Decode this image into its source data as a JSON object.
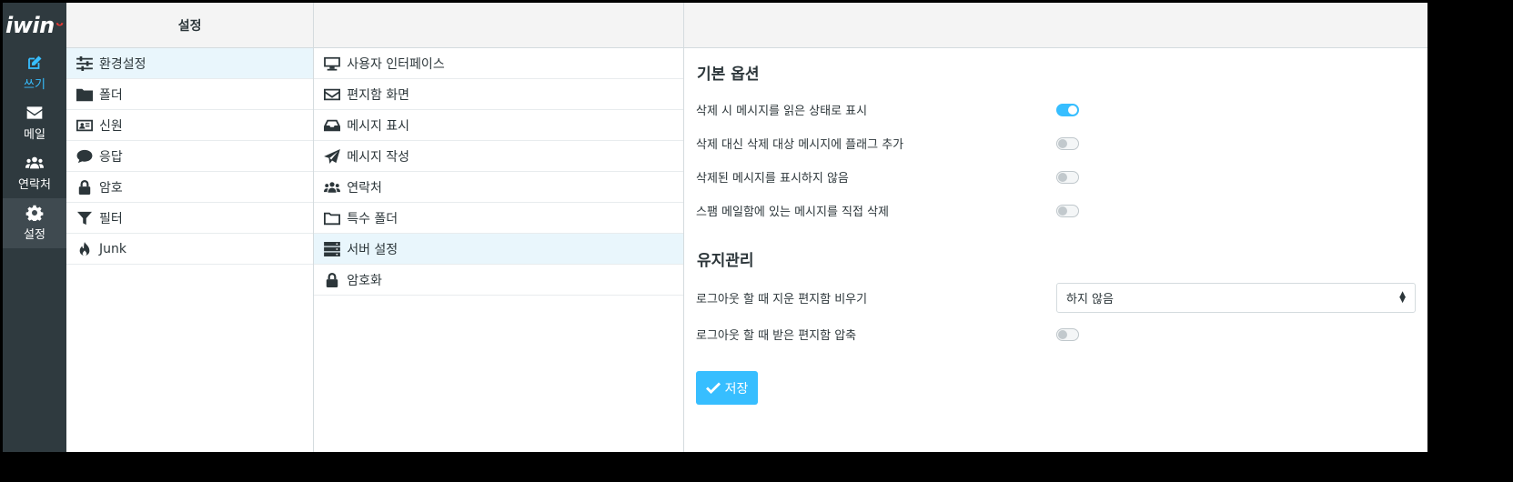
{
  "logo": {
    "text": "iwin",
    "mark": "ᵕ"
  },
  "nav": [
    {
      "label": "쓰기",
      "icon": "compose-icon"
    },
    {
      "label": "메일",
      "icon": "envelope-icon"
    },
    {
      "label": "연락처",
      "icon": "contacts-icon"
    },
    {
      "label": "설정",
      "icon": "gear-icon"
    }
  ],
  "col1": {
    "header": "설정",
    "items": [
      {
        "label": "환경설정",
        "icon": "sliders-icon"
      },
      {
        "label": "폴더",
        "icon": "folder-icon"
      },
      {
        "label": "신원",
        "icon": "id-card-icon"
      },
      {
        "label": "응답",
        "icon": "comment-icon"
      },
      {
        "label": "암호",
        "icon": "lock-icon"
      },
      {
        "label": "필터",
        "icon": "filter-icon"
      },
      {
        "label": "Junk",
        "icon": "fire-icon"
      }
    ]
  },
  "col2": {
    "items": [
      {
        "label": "사용자 인터페이스",
        "icon": "monitor-icon"
      },
      {
        "label": "편지함 화면",
        "icon": "envelope-outline-icon"
      },
      {
        "label": "메시지 표시",
        "icon": "inbox-icon"
      },
      {
        "label": "메시지 작성",
        "icon": "paper-plane-icon"
      },
      {
        "label": "연락처",
        "icon": "users-icon"
      },
      {
        "label": "특수 폴더",
        "icon": "folder-outline-icon"
      },
      {
        "label": "서버 설정",
        "icon": "server-icon"
      },
      {
        "label": "암호화",
        "icon": "lock-icon"
      }
    ]
  },
  "form": {
    "section1_title": "기본 옵션",
    "options1": [
      {
        "label": "삭제 시 메시지를 읽은 상태로 표시",
        "on": true
      },
      {
        "label": "삭제 대신 삭제 대상 메시지에 플래그 추가",
        "on": false
      },
      {
        "label": "삭제된 메시지를 표시하지 않음",
        "on": false
      },
      {
        "label": "스팸 메일함에 있는 메시지를 직접 삭제",
        "on": false
      }
    ],
    "section2_title": "유지관리",
    "select_label": "로그아웃 할 때 지운 편지함 비우기",
    "select_value": "하지 않음",
    "compact_label": "로그아웃 할 때 받은 편지함 압축",
    "compact_on": false,
    "save_label": "저장"
  },
  "colors": {
    "accent": "#37beff",
    "sidebar": "#2f3a3f",
    "selected_row": "#e9f6fc"
  }
}
